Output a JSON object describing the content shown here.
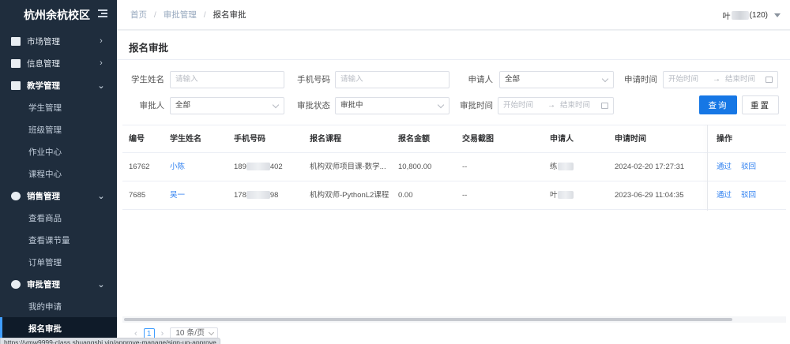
{
  "sidebar": {
    "brand": "杭州余杭校区",
    "groups": [
      {
        "label": "市场管理",
        "icon": "briefcase-icon",
        "open": false
      },
      {
        "label": "信息管理",
        "icon": "document-icon",
        "open": false
      },
      {
        "label": "教学管理",
        "icon": "book-icon",
        "open": true,
        "items": [
          "学生管理",
          "班级管理",
          "作业中心",
          "课程中心"
        ]
      },
      {
        "label": "销售管理",
        "icon": "globe-icon",
        "open": true,
        "items": [
          "查看商品",
          "查看课节量",
          "订单管理"
        ]
      },
      {
        "label": "审批管理",
        "icon": "user-icon",
        "open": true,
        "items": [
          "我的申请",
          "报名审批"
        ]
      }
    ]
  },
  "header": {
    "breadcrumb": [
      "首页",
      "审批管理",
      "报名审批"
    ],
    "breadcrumb_sep": "/",
    "user_prefix": "叶",
    "user_suffix": "(120)"
  },
  "page": {
    "title": "报名审批",
    "filters": {
      "student_name_label": "学生姓名",
      "student_name_placeholder": "请输入",
      "phone_label": "手机号码",
      "phone_placeholder": "请输入",
      "applicant_label": "申请人",
      "applicant_value": "全部",
      "apply_time_label": "申请时间",
      "start_placeholder": "开始时间",
      "end_placeholder": "结束时间",
      "range_sep": "→",
      "approver_label": "审批人",
      "approver_value": "全部",
      "status_label": "审批状态",
      "status_value": "审批中",
      "approve_time_label": "审批时间",
      "query_button": "查询",
      "reset_button": "重置"
    },
    "table": {
      "columns": [
        "编号",
        "学生姓名",
        "手机号码",
        "报名课程",
        "报名金额",
        "交易截图",
        "申请人",
        "申请时间",
        "操作"
      ],
      "rows": [
        {
          "id": "16762",
          "student": "小陈",
          "phone_prefix": "189",
          "phone_suffix": "402",
          "course": "机构双师项目课-数学...",
          "amount": "10,800.00",
          "screenshot": "--",
          "applicant_prefix": "练",
          "time": "2024-02-20 17:27:31",
          "approve": "通过",
          "reject": "驳回"
        },
        {
          "id": "7685",
          "student": "吴一",
          "phone_prefix": "178",
          "phone_suffix": "98",
          "course": "机构双师-PythonL2课程",
          "amount": "0.00",
          "screenshot": "--",
          "applicant_prefix": "叶",
          "time": "2023-06-29 11:04:35",
          "approve": "通过",
          "reject": "驳回"
        }
      ]
    },
    "pagination": {
      "prev": "‹",
      "current": "1",
      "next": "›",
      "page_size": "10 条/页"
    }
  },
  "statusbar": {
    "url": "https://ymw9999-class.shuangshi.vip/approve-manage/sign-up-approve"
  }
}
